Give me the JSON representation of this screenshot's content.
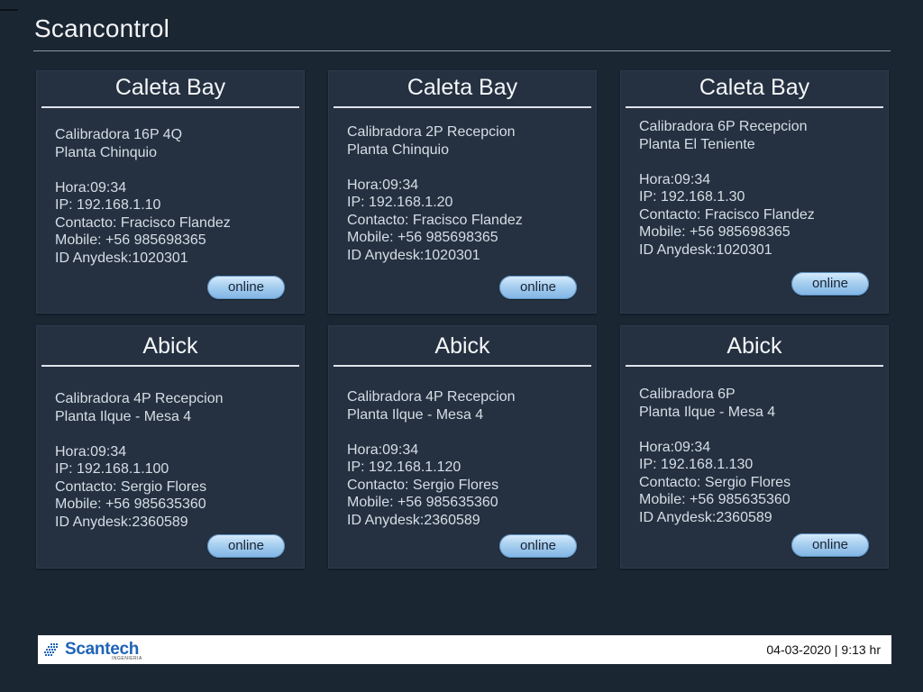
{
  "app": {
    "title": "Scancontrol"
  },
  "cards": [
    {
      "client": "Caleta Bay",
      "device": "Calibradora 16P 4Q",
      "plant": "Planta Chinquio",
      "hora": "Hora:09:34",
      "ip": "IP: 192.168.1.10",
      "contacto": "Contacto: Fracisco Flandez",
      "mobile": "Mobile: +56 985698365",
      "anydesk": "ID Anydesk:1020301",
      "status": "online"
    },
    {
      "client": "Caleta Bay",
      "device": "Calibradora 2P Recepcion",
      "plant": "Planta Chinquio",
      "hora": "Hora:09:34",
      "ip": "IP: 192.168.1.20",
      "contacto": "Contacto: Fracisco Flandez",
      "mobile": "Mobile: +56 985698365",
      "anydesk": "ID Anydesk:1020301",
      "status": "online"
    },
    {
      "client": "Caleta Bay",
      "device": "Calibradora 6P Recepcion",
      "plant": "Planta El Teniente",
      "hora": "Hora:09:34",
      "ip": "IP: 192.168.1.30",
      "contacto": "Contacto: Fracisco Flandez",
      "mobile": "Mobile: +56 985698365",
      "anydesk": "ID Anydesk:1020301",
      "status": "online"
    },
    {
      "client": "Abick",
      "device": "Calibradora 4P Recepcion",
      "plant": "Planta Ilque - Mesa 4",
      "hora": "Hora:09:34",
      "ip": "IP: 192.168.1.100",
      "contacto": "Contacto: Sergio Flores",
      "mobile": "Mobile: +56 985635360",
      "anydesk": "ID Anydesk:2360589",
      "status": "online"
    },
    {
      "client": "Abick",
      "device": "Calibradora 4P Recepcion",
      "plant": "Planta Ilque - Mesa 4",
      "hora": "Hora:09:34",
      "ip": "IP: 192.168.1.120",
      "contacto": "Contacto: Sergio Flores",
      "mobile": "Mobile: +56 985635360",
      "anydesk": "ID Anydesk:2360589",
      "status": "online"
    },
    {
      "client": "Abick",
      "device": "Calibradora 6P",
      "plant": "Planta Ilque - Mesa 4",
      "hora": "Hora:09:34",
      "ip": "IP: 192.168.1.130",
      "contacto": "Contacto: Sergio Flores",
      "mobile": "Mobile: +56 985635360",
      "anydesk": "ID Anydesk:2360589",
      "status": "online"
    }
  ],
  "footer": {
    "brand": "Scantech",
    "brand_sub": "INGENIERIA",
    "brand_icon": "scantech-logo-icon",
    "datetime": "04-03-2020 | 9:13 hr"
  },
  "colors": {
    "background": "#1b2633",
    "card": "#253141",
    "button": "#a8cff0",
    "brand": "#1f64b8"
  }
}
